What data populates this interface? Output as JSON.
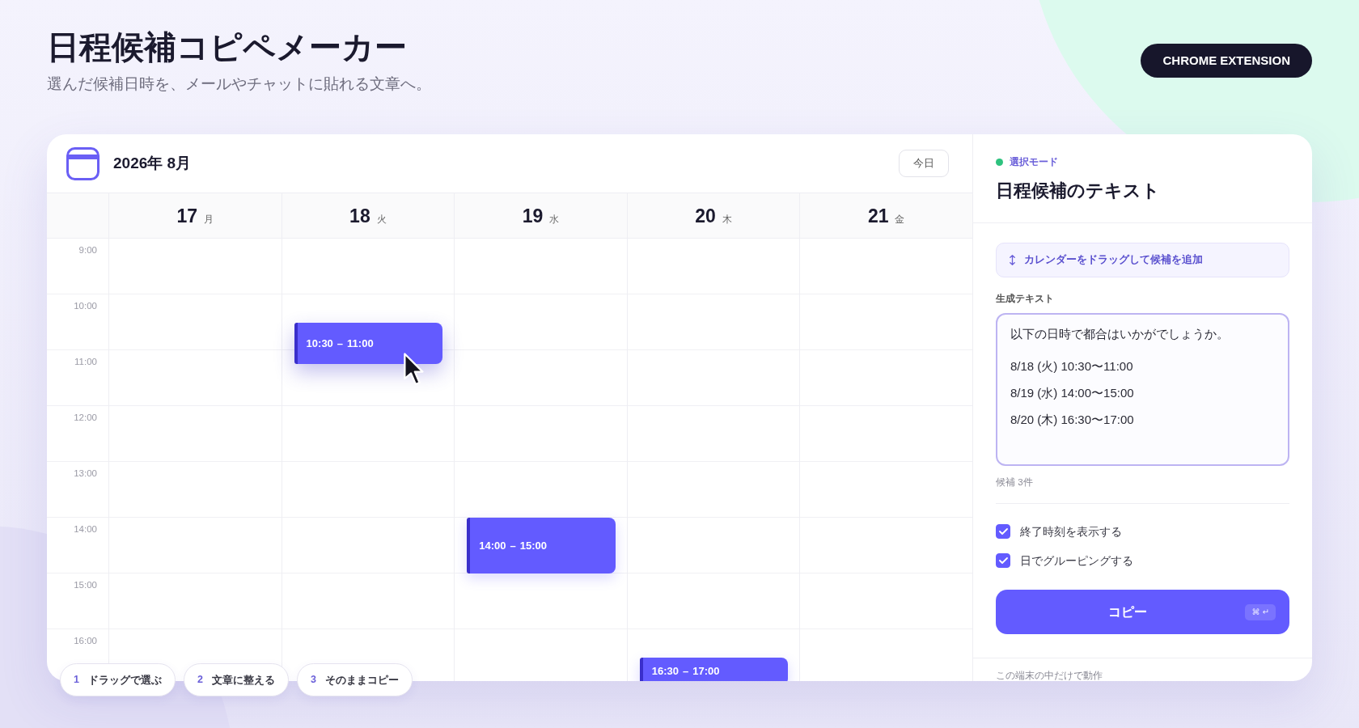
{
  "header": {
    "title": "日程候補コピペメーカー",
    "subtitle": "選んだ候補日時を、メールやチャットに貼れる文章へ。",
    "badge": "CHROME EXTENSION"
  },
  "calendar": {
    "month": "2026年 8月",
    "today_button": "今日",
    "days": [
      {
        "date": "17",
        "weekday": "月"
      },
      {
        "date": "18",
        "weekday": "火",
        "events": [
          {
            "start": "10:30",
            "separator": "–",
            "end": "11:00",
            "dragging": true
          }
        ]
      },
      {
        "date": "19",
        "weekday": "水",
        "events": [
          {
            "start": "14:00",
            "separator": "–",
            "end": "15:00",
            "dragging": false
          }
        ]
      },
      {
        "date": "20",
        "weekday": "木",
        "events": [
          {
            "start": "16:30",
            "separator": "–",
            "end": "17:00",
            "dragging": false
          }
        ]
      },
      {
        "date": "21",
        "weekday": "金"
      }
    ],
    "hours": [
      "9:00",
      "10:00",
      "11:00",
      "12:00",
      "13:00",
      "14:00",
      "15:00",
      "16:00"
    ]
  },
  "steps": [
    {
      "number": "1",
      "label": "ドラッグで選ぶ"
    },
    {
      "number": "2",
      "label": "文章に整える"
    },
    {
      "number": "3",
      "label": "そのままコピー"
    }
  ],
  "panel": {
    "mode": "選択モード",
    "title": "日程候補のテキスト",
    "hint": "カレンダーをドラッグして候補を追加",
    "text_label": "生成テキスト",
    "generated_text": {
      "intro": "以下の日時で都合はいかがでしょうか。",
      "lines": [
        "8/18 (火) 10:30〜11:00",
        "8/19 (水) 14:00〜15:00",
        "8/20 (木) 16:30〜17:00"
      ]
    },
    "count": "候補 3件",
    "options": [
      {
        "label": "終了時刻を表示する",
        "checked": true
      },
      {
        "label": "日でグルーピングする",
        "checked": true
      }
    ],
    "copy_button": {
      "label": "コピー",
      "shortcut": "⌘ ↵"
    },
    "footer": "この端末の中だけで動作"
  }
}
